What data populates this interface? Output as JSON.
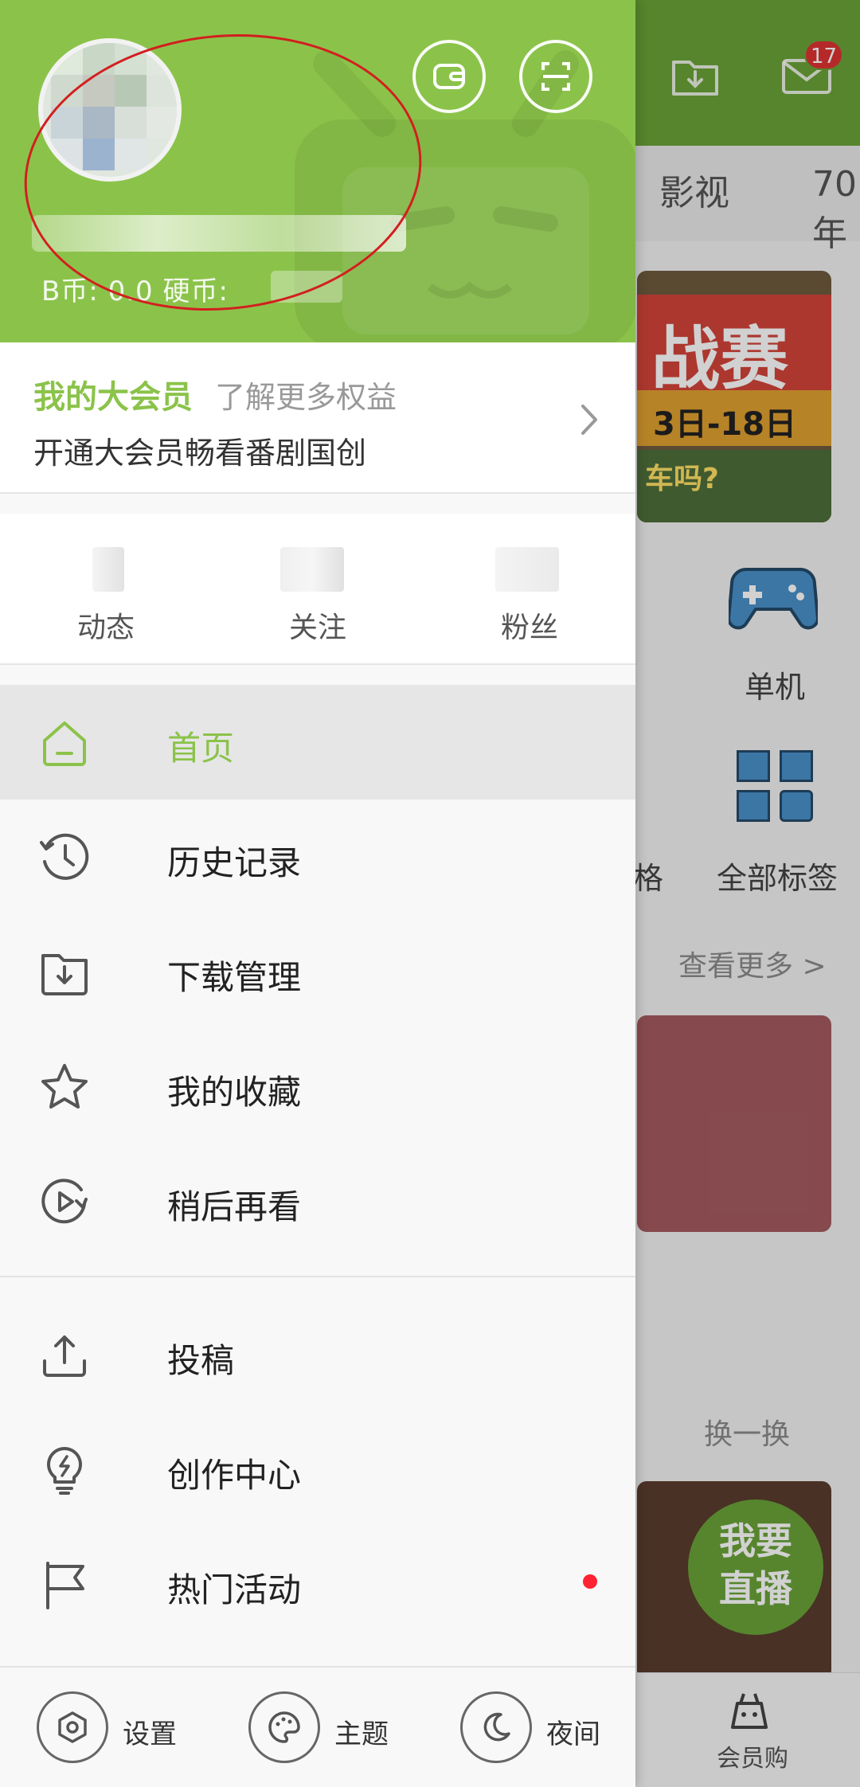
{
  "background": {
    "badge_count": "17",
    "tabs": [
      "影视",
      "70年"
    ],
    "banner_text_big": "战赛",
    "banner_text_date": "3日-18日",
    "banner_text_small": "车吗?",
    "grid_labels": [
      "单机",
      "格",
      "全部标签"
    ],
    "see_more": "查看更多 >",
    "refresh": "换一换",
    "live_button": "我要\n直播",
    "bottom_nav_label": "会员购"
  },
  "profile": {
    "coins_text": "B币: 0.0   硬币:"
  },
  "vip": {
    "title": "我的大会员",
    "more": "了解更多权益",
    "subtitle": "开通大会员畅看番剧国创"
  },
  "stats": [
    {
      "label": "动态"
    },
    {
      "label": "关注"
    },
    {
      "label": "粉丝"
    }
  ],
  "menu_group1": [
    {
      "label": "首页",
      "icon": "home-icon",
      "active": true
    },
    {
      "label": "历史记录",
      "icon": "history-icon"
    },
    {
      "label": "下载管理",
      "icon": "download-folder-icon"
    },
    {
      "label": "我的收藏",
      "icon": "star-icon"
    },
    {
      "label": "稍后再看",
      "icon": "watch-later-icon"
    }
  ],
  "menu_group2": [
    {
      "label": "投稿",
      "icon": "upload-icon"
    },
    {
      "label": "创作中心",
      "icon": "lightbulb-icon"
    },
    {
      "label": "热门活动",
      "icon": "flag-icon",
      "dot": true
    }
  ],
  "bottom_bar": {
    "settings": "设置",
    "theme": "主题",
    "night": "夜间"
  },
  "colors": {
    "accent_green": "#8bc34a",
    "dark_green": "#6aa338",
    "notification_red": "#f23",
    "annotation_red": "#d21f1f"
  }
}
